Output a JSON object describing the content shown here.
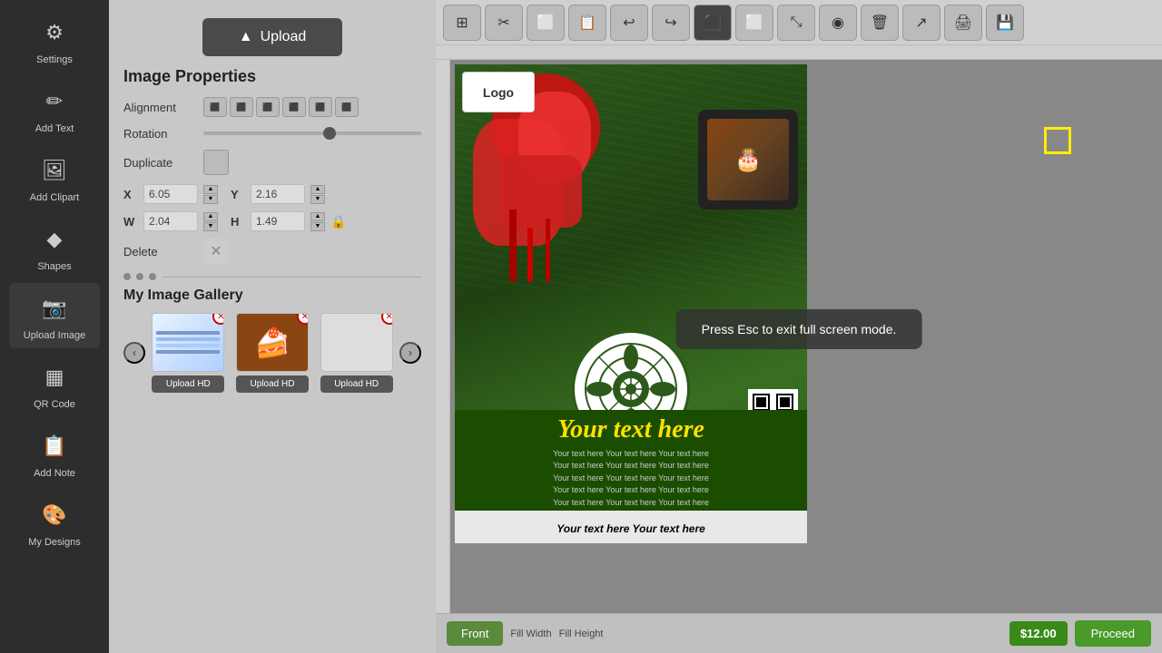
{
  "sidebar": {
    "items": [
      {
        "id": "settings",
        "label": "Settings",
        "icon": "⚙"
      },
      {
        "id": "add-text",
        "label": "Add Text",
        "icon": "✏"
      },
      {
        "id": "add-clipart",
        "label": "Add Clipart",
        "icon": "🖼"
      },
      {
        "id": "shapes",
        "label": "Shapes",
        "icon": "◆"
      },
      {
        "id": "upload-image",
        "label": "Upload Image",
        "icon": "📷"
      },
      {
        "id": "qr-code",
        "label": "QR Code",
        "icon": "▦"
      },
      {
        "id": "add-note",
        "label": "Add Note",
        "icon": "📋"
      },
      {
        "id": "my-designs",
        "label": "My Designs",
        "icon": "🎨"
      }
    ]
  },
  "panel": {
    "upload_label": "Upload",
    "image_properties_title": "Image Properties",
    "alignment_label": "Alignment",
    "rotation_label": "Rotation",
    "rotation_value": 45,
    "duplicate_label": "Duplicate",
    "x_label": "X",
    "x_value": "6.05",
    "y_label": "Y",
    "y_value": "2.16",
    "w_label": "W",
    "w_value": "2.04",
    "h_label": "H",
    "h_value": "1.49",
    "delete_label": "Delete",
    "gallery_title": "My Image Gallery",
    "upload_hd_labels": [
      "Upload HD",
      "Upload HD",
      "Upload HD"
    ]
  },
  "toolbar": {
    "buttons": [
      {
        "id": "grid",
        "icon": "⊞",
        "label": "Grid"
      },
      {
        "id": "cut",
        "icon": "✂",
        "label": "Cut"
      },
      {
        "id": "copy",
        "icon": "⬜",
        "label": "Copy"
      },
      {
        "id": "paste",
        "icon": "📋",
        "label": "Paste"
      },
      {
        "id": "undo",
        "icon": "↩",
        "label": "Undo"
      },
      {
        "id": "redo",
        "icon": "↪",
        "label": "Redo"
      },
      {
        "id": "front",
        "icon": "⬛",
        "label": "Bring to Front"
      },
      {
        "id": "back",
        "icon": "⬜",
        "label": "Send to Back"
      },
      {
        "id": "resize",
        "icon": "⤡",
        "label": "Resize"
      },
      {
        "id": "preview",
        "icon": "◉",
        "label": "Preview"
      },
      {
        "id": "delete",
        "icon": "🗑",
        "label": "Delete"
      },
      {
        "id": "share",
        "icon": "↗",
        "label": "Share"
      },
      {
        "id": "print",
        "icon": "🖨",
        "label": "Print"
      },
      {
        "id": "save",
        "icon": "💾",
        "label": "Save"
      }
    ]
  },
  "canvas": {
    "overlay_message": "Press Esc to exit full screen mode.",
    "logo_text": "Logo",
    "main_text": "Your text here",
    "body_text_line1": "Your text here Your text here Your text here",
    "body_text_line2": "Your text here Your text here Your text here",
    "body_text_line3": "Your text here Your text here Your text here",
    "body_text_line4": "Your text here Your text here Your text here",
    "body_text_line5": "Your text here Your text here Your text here",
    "footer_text": "Your text here  Your text here"
  },
  "bottom_bar": {
    "tab_label": "Front",
    "fill_width_label": "Fill Width",
    "fill_height_label": "Fill Height",
    "price": "$12.00",
    "proceed_label": "Proceed"
  }
}
